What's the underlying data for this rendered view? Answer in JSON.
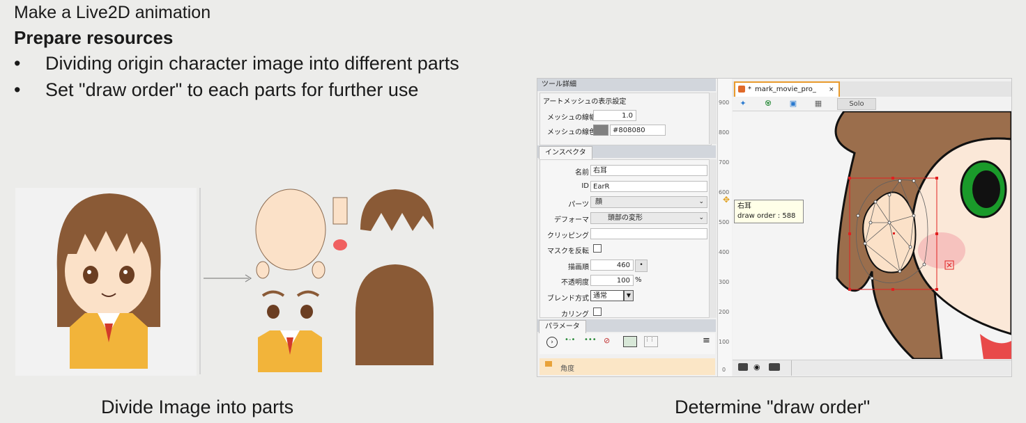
{
  "slide": {
    "subtitle": "Make a Live2D animation",
    "title": "Prepare resources",
    "bullets": [
      {
        "mark": "•",
        "text": "Dividing origin character image into different parts"
      },
      {
        "mark": "•",
        "text": "Set \"draw order\" to each parts for further use"
      }
    ],
    "caption_left": "Divide Image into parts",
    "caption_right": "Determine \"draw order\""
  },
  "editor": {
    "tool_detail_tab": "ツール詳細",
    "art_mesh_section": "アートメッシュの表示設定",
    "mesh_width_label": "メッシュの線幅",
    "mesh_width_value": "1.0",
    "mesh_color_label": "メッシュの線色",
    "mesh_color_value": "#808080",
    "mesh_color_swatch": "#808080",
    "inspector_tab": "インスペクタ",
    "name_label": "名前",
    "name_value": "右耳",
    "id_label": "ID",
    "id_value": "EarR",
    "parts_label": "パーツ",
    "parts_value": "顔",
    "deformer_label": "デフォーマ",
    "deformer_value": "頭部の変形",
    "clipping_label": "クリッピング",
    "clipping_value": "",
    "invert_mask_label": "マスクを反転",
    "draw_order_label": "描画順",
    "draw_order_value": "460",
    "opacity_label": "不透明度",
    "opacity_value": "100",
    "opacity_unit": "%",
    "blend_label": "ブレンド方式",
    "blend_value": "通常",
    "culling_label": "カリング",
    "parameter_tab": "パラメータ",
    "param_item": "角度",
    "document_tab": "mark_movie_pro_",
    "solo_button": "Solo",
    "tooltip_name": "右耳",
    "tooltip_order": "draw order : 588",
    "ruler_numbers": [
      "900",
      "800",
      "700",
      "600",
      "500",
      "400",
      "300",
      "200",
      "100",
      "0"
    ],
    "colors": {
      "accent_tab": "#e89a2c",
      "selection": "#e02020",
      "mesh": "#606060",
      "eye_green": "#1a9a2a",
      "hair": "#9b6e4c"
    }
  }
}
